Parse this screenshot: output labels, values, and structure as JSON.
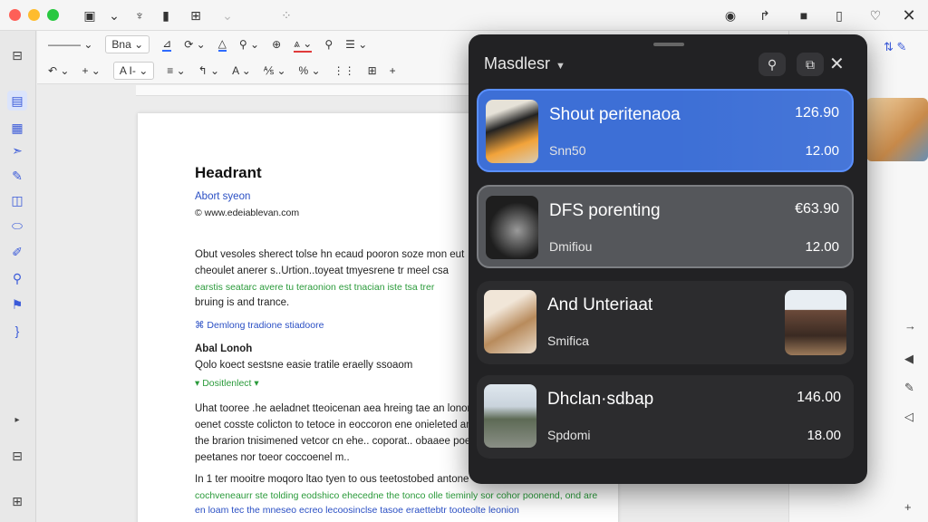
{
  "document": {
    "heading": "Headrant",
    "byline": "Abort syeon",
    "source": "© www.edeiablevan.com",
    "para1": [
      "Obut vesoles sherect tolse hn ecaud pooron soze mon eut",
      "cheoulet anerer s..Urtion..toyeat tmyesrene tr meel csa",
      "earstis seatarc avere tu teraonion est tnacian iste tsa trer",
      "bruing is and trance."
    ],
    "link1": "⌘ Demlong tradione stiadoore",
    "subhead": "Abal Lonoh",
    "line2": "Qolo koect sestsne easie tratile eraelly ssoaom",
    "collapsible": "Dositlenlect",
    "para2": [
      "Uhat tooree .he aeladnet tteoicenan aea hreing tae an lonor",
      "oenet cosste colicton to tetoce in eoccoron ene onieleted ane",
      "the brarion tnisimened vetcor cn ehe.. coporat.. obaaee poe",
      "peetanes nor toeor coccoenel m.."
    ],
    "para3": [
      "In 1 ter mooitre moqoro ltao tyen to ous teetostobed antone",
      "cochveneaurr ste tolding eodshico ehecedne the tonco olle tieminly sor cohor  poonend, ond are",
      "en loam tec the mneseo ecreo lecoosinclse tasoe eraettebtr tooteolte leonion"
    ]
  },
  "popup": {
    "title": "Masdlesr",
    "search_icon": "search-icon",
    "layout_icon": "window-icon",
    "close_icon": "close-icon",
    "items": [
      {
        "title": "Shout peritenaoa",
        "subtitle": "Snn50",
        "value1": "126.90",
        "value2": "12.00",
        "state": "selected"
      },
      {
        "title": "DFS porenting",
        "subtitle": "Dmifiou",
        "value1": "€63.90",
        "value2": "12.00",
        "state": "hover"
      },
      {
        "title": "And Unteriaat",
        "subtitle": "Smifica",
        "value1": "",
        "value2": "",
        "state": "plain"
      },
      {
        "title": "Dhclan·sdbap",
        "subtitle": "Spdomi",
        "value1": "146.00",
        "value2": "18.00",
        "state": "plain"
      }
    ]
  },
  "toolbar": {
    "font_label": "Bna",
    "style_label": "A I-"
  },
  "colors": {
    "accent": "#3d6fd6",
    "panel_bg": "#222224",
    "link_blue": "#2a4fc4",
    "link_green": "#2a9a3a"
  }
}
